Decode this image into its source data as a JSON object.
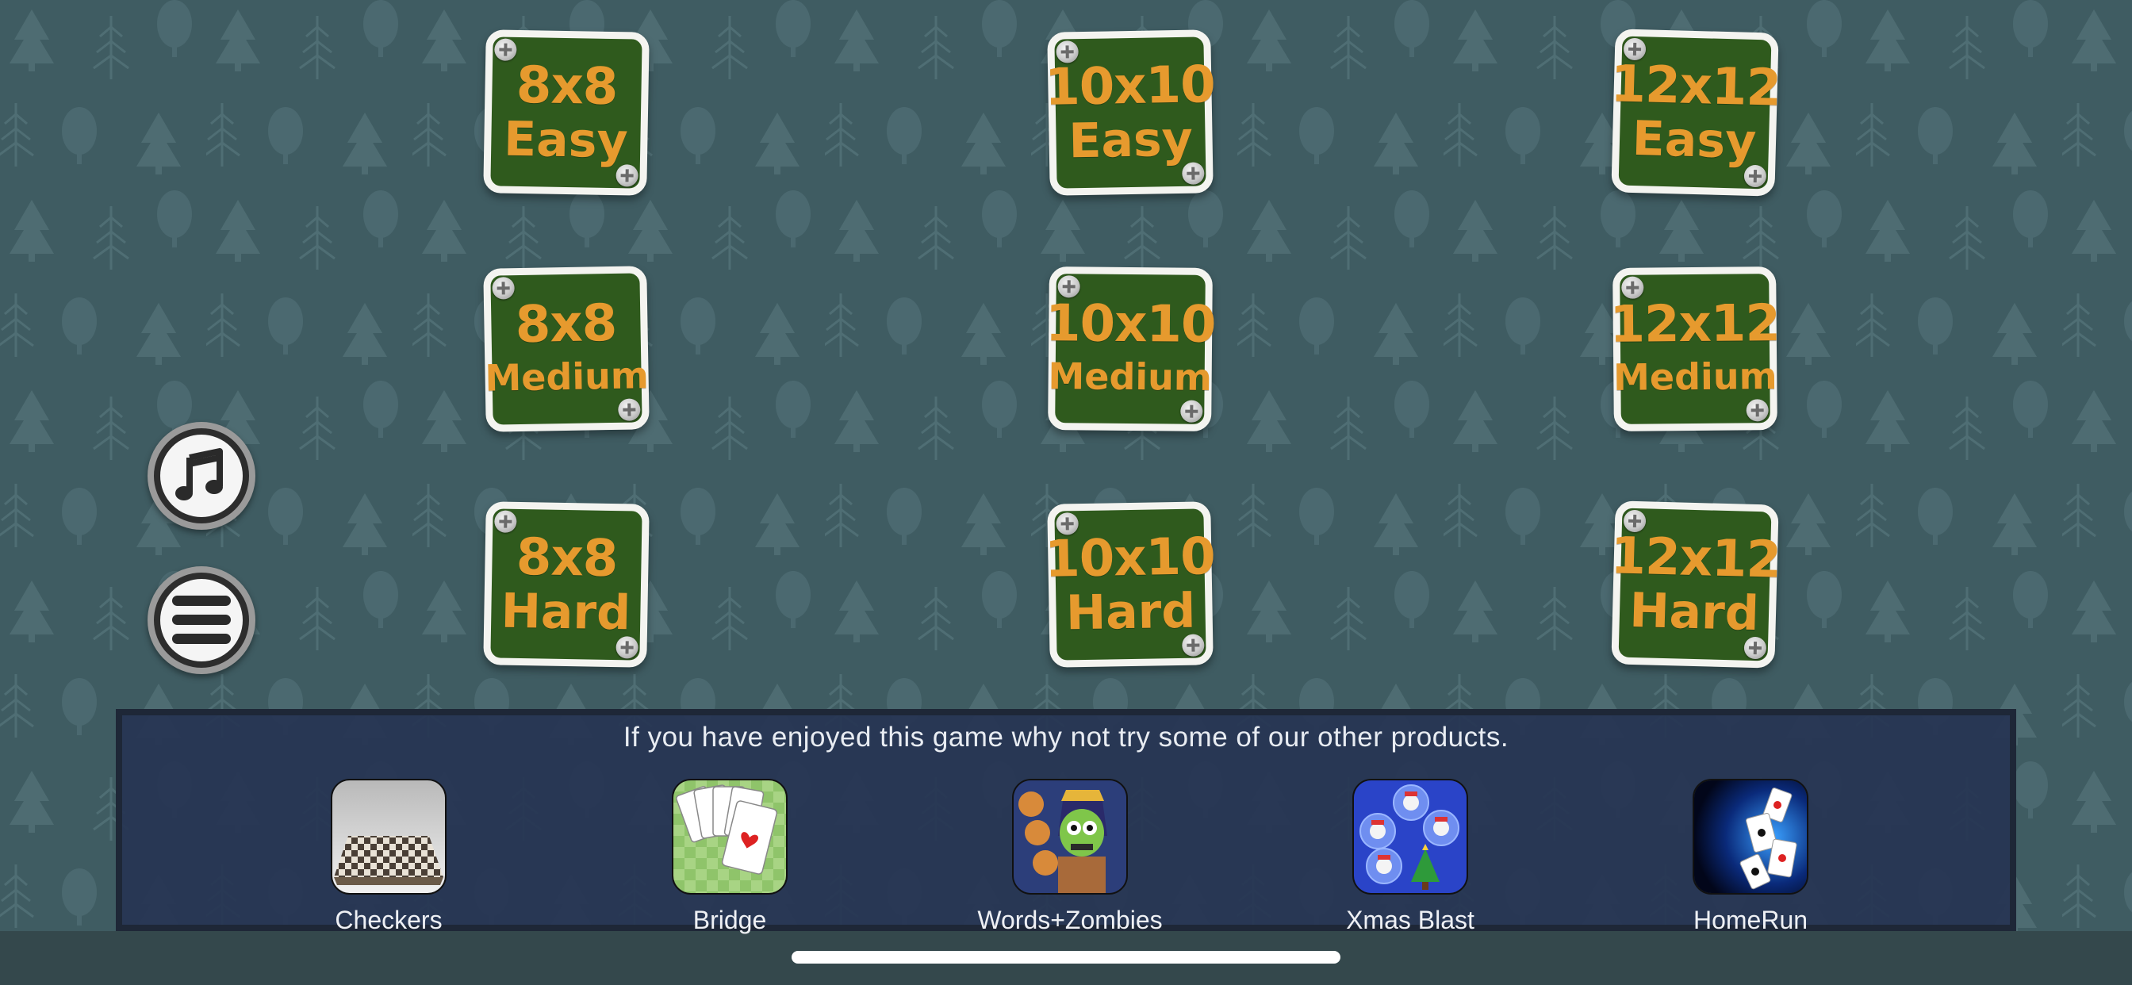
{
  "levels": [
    {
      "size": "8x8",
      "level": "Easy"
    },
    {
      "size": "10x10",
      "level": "Easy"
    },
    {
      "size": "12x12",
      "level": "Easy"
    },
    {
      "size": "8x8",
      "level": "Medium"
    },
    {
      "size": "10x10",
      "level": "Medium"
    },
    {
      "size": "12x12",
      "level": "Medium"
    },
    {
      "size": "8x8",
      "level": "Hard"
    },
    {
      "size": "10x10",
      "level": "Hard"
    },
    {
      "size": "12x12",
      "level": "Hard"
    }
  ],
  "controls": {
    "music_icon": "music-note-icon",
    "menu_icon": "hamburger-menu-icon"
  },
  "promo": {
    "heading": "If you have enjoyed this game why not try some of our other products.",
    "products": [
      {
        "name": "Checkers",
        "icon": "checkers-board-icon"
      },
      {
        "name": "Bridge",
        "icon": "playing-cards-fan-icon"
      },
      {
        "name": "Words+Zombies",
        "icon": "zombie-pharaoh-icon"
      },
      {
        "name": "Xmas Blast",
        "icon": "snowman-bubbles-icon"
      },
      {
        "name": "HomeRun",
        "icon": "flying-cards-icon"
      }
    ]
  },
  "colors": {
    "background": "#3f5c62",
    "tile_green": "#2f5a1d",
    "tile_text": "#e69a2e",
    "promo_panel": "#263452"
  }
}
